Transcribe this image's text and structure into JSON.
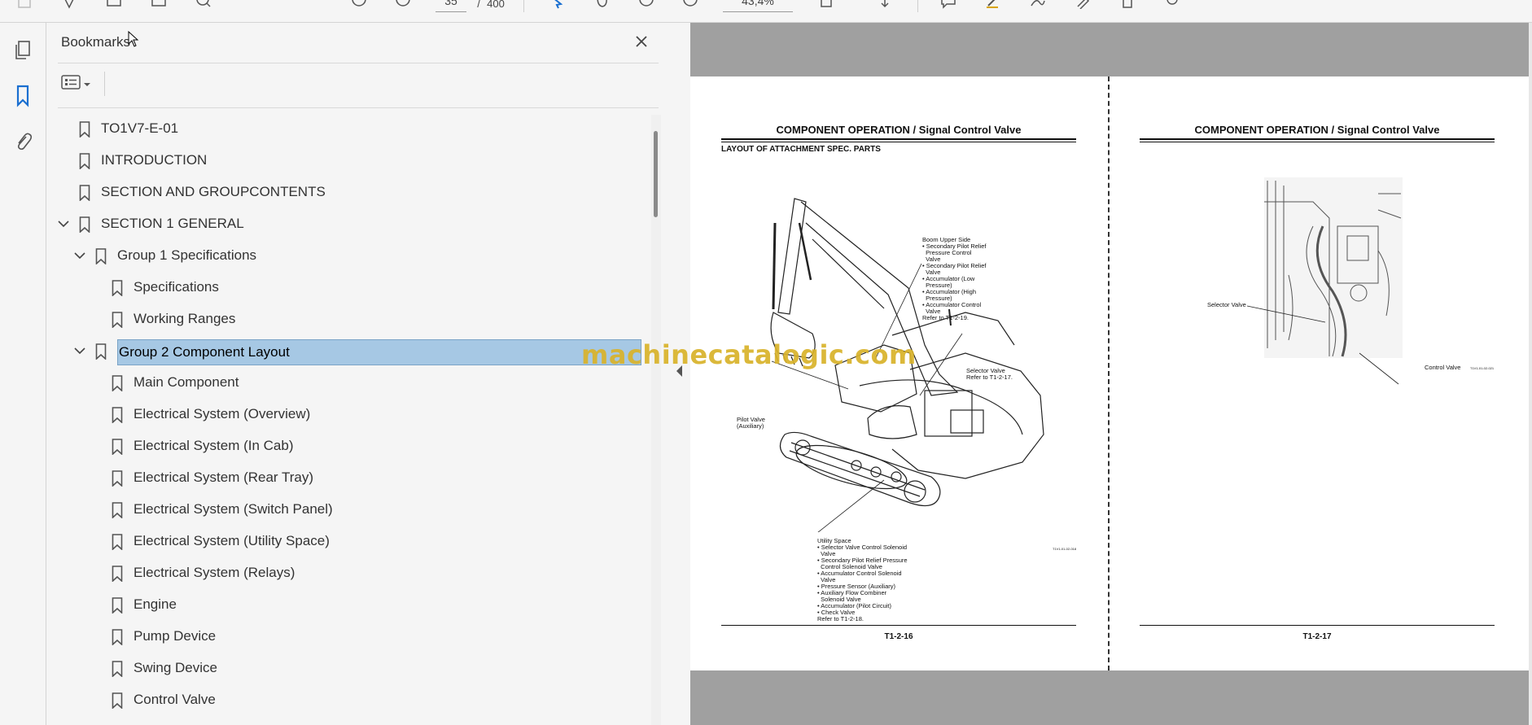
{
  "toolbar": {
    "page_current": "35",
    "page_separator": "/",
    "page_total": "400",
    "zoom": "43,4%"
  },
  "rail": {
    "items": [
      "page-thumbnails",
      "bookmarks",
      "attachments"
    ]
  },
  "panel": {
    "title": "Bookmarks",
    "close_label": "✕"
  },
  "bookmarks": [
    {
      "label": "TO1V7-E-01",
      "level": 0,
      "expanded": null
    },
    {
      "label": "INTRODUCTION",
      "level": 0,
      "expanded": null
    },
    {
      "label": "SECTION AND GROUPCONTENTS",
      "level": 0,
      "expanded": null
    },
    {
      "label": "SECTION 1 GENERAL",
      "level": 0,
      "expanded": true
    },
    {
      "label": "Group 1 Specifications",
      "level": 1,
      "expanded": true
    },
    {
      "label": "Specifications",
      "level": 2,
      "expanded": null
    },
    {
      "label": "Working Ranges",
      "level": 2,
      "expanded": null
    },
    {
      "label": "Group 2 Component Layout",
      "level": 1,
      "expanded": true,
      "selected": true
    },
    {
      "label": "Main Component",
      "level": 2,
      "expanded": null
    },
    {
      "label": "Electrical System (Overview)",
      "level": 2,
      "expanded": null
    },
    {
      "label": "Electrical System (In Cab)",
      "level": 2,
      "expanded": null
    },
    {
      "label": "Electrical System (Rear Tray)",
      "level": 2,
      "expanded": null
    },
    {
      "label": "Electrical System (Switch Panel)",
      "level": 2,
      "expanded": null
    },
    {
      "label": "Electrical System (Utility Space)",
      "level": 2,
      "expanded": null
    },
    {
      "label": "Electrical System (Relays)",
      "level": 2,
      "expanded": null
    },
    {
      "label": "Engine",
      "level": 2,
      "expanded": null
    },
    {
      "label": "Pump Device",
      "level": 2,
      "expanded": null
    },
    {
      "label": "Swing Device",
      "level": 2,
      "expanded": null
    },
    {
      "label": "Control Valve",
      "level": 2,
      "expanded": null
    }
  ],
  "document": {
    "left_page": {
      "title": "COMPONENT OPERATION / Signal Control Valve",
      "subtitle": "LAYOUT OF ATTACHMENT SPEC. PARTS",
      "footer": "T1-2-16",
      "fig_id": "T1V1-01-02-018",
      "annotations": {
        "boom": "Boom Upper Side\n• Secondary Pilot Relief\n  Pressure Control\n  Valve\n• Secondary Pilot Relief\n  Valve\n• Accumulator (Low\n  Pressure)\n• Accumulator (High\n  Pressure)\n• Accumulator Control\n  Valve\nRefer to T1-2-19.",
        "selector": "Selector Valve\nRefer to T1-2-17.",
        "pilot": "Pilot Valve\n(Auxiliary)",
        "utility": "Utility Space\n• Selector Valve Control Solenoid\n  Valve\n• Secondary Pilot Relief Pressure\n  Control Solenoid Valve\n• Accumulator Control Solenoid\n  Valve\n• Pressure Sensor (Auxiliary)\n• Auxiliary Flow Combiner\n  Solenoid Valve\n• Accumulator (Pilot Circuit)\n• Check Valve\nRefer to T1-2-18."
      }
    },
    "right_page": {
      "title": "COMPONENT OPERATION / Signal Control Valve",
      "footer": "T1-2-17",
      "fig_id": "T1V1-01-02-021",
      "annotations": {
        "selector": "Selector Valve",
        "control": "Control Valve"
      }
    },
    "watermark": "machinecatalogic.com"
  }
}
